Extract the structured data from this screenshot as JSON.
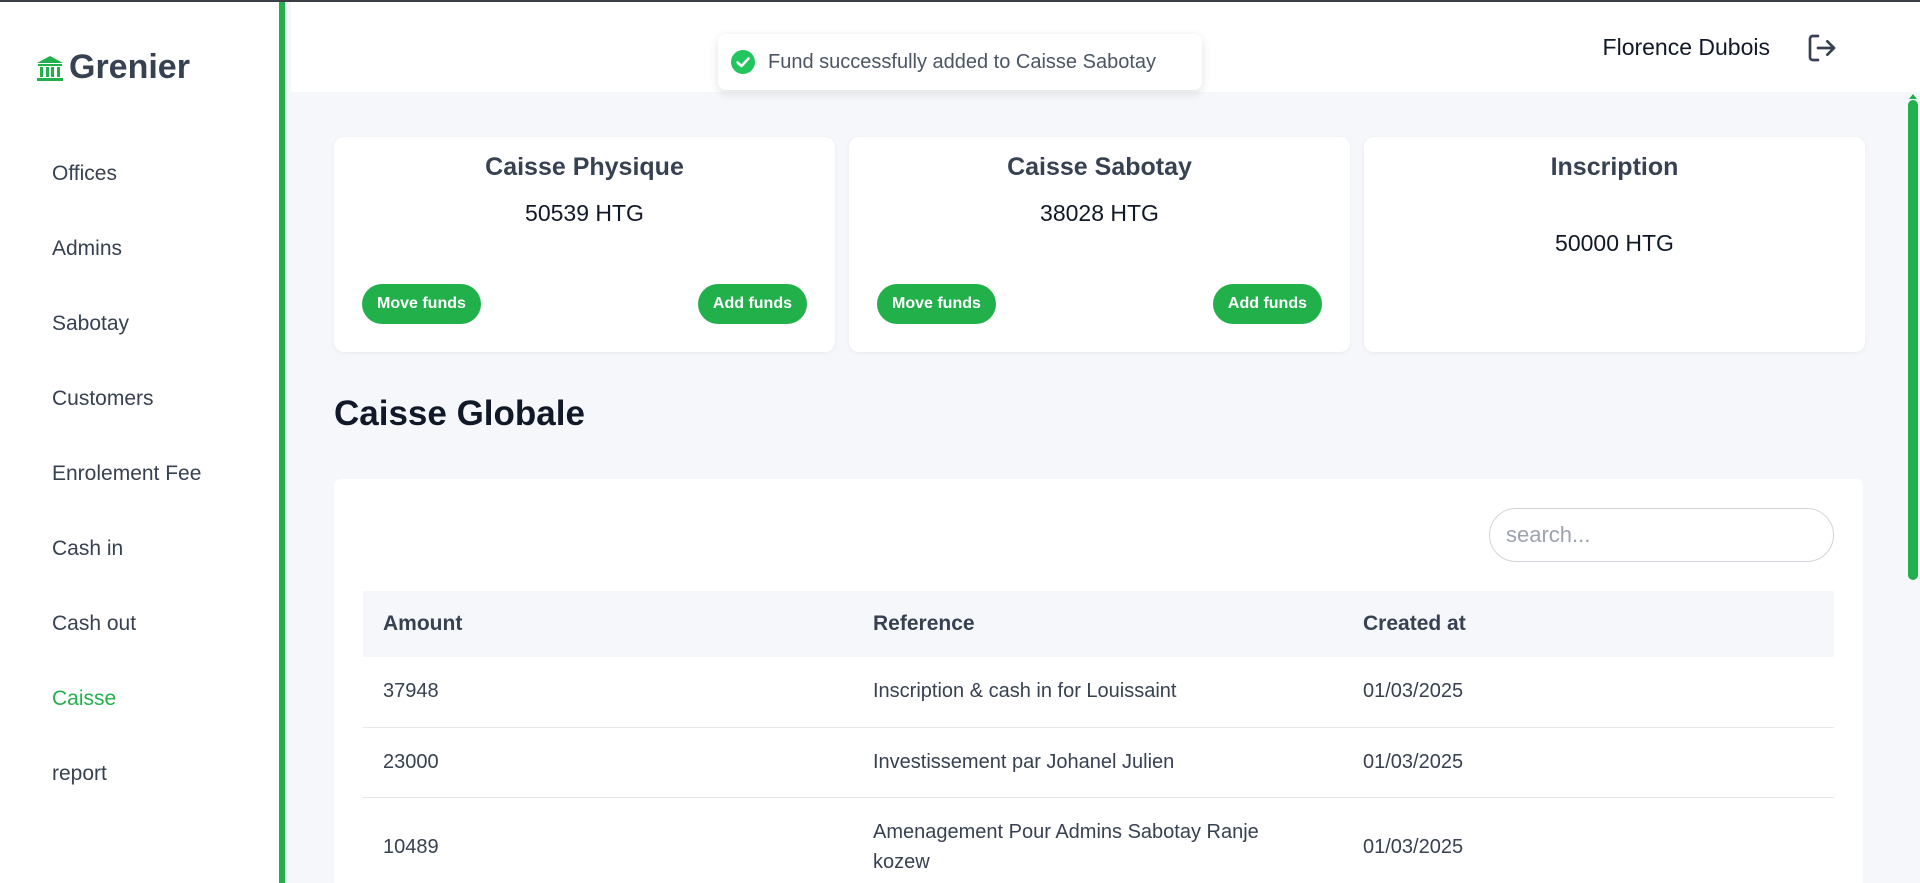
{
  "app": {
    "logo_text": "Grenier",
    "accent_color": "#22b04b"
  },
  "sidebar": {
    "items": [
      {
        "label": "Offices"
      },
      {
        "label": "Admins"
      },
      {
        "label": "Sabotay"
      },
      {
        "label": "Customers"
      },
      {
        "label": "Enrolement Fee"
      },
      {
        "label": "Cash in"
      },
      {
        "label": "Cash out"
      },
      {
        "label": "Caisse",
        "active": true
      },
      {
        "label": "report"
      }
    ]
  },
  "header": {
    "user_name": "Florence Dubois",
    "logout_icon": "logout-icon"
  },
  "toast": {
    "message": "Fund successfully added to Caisse Sabotay",
    "icon": "check-circle-icon"
  },
  "cards": [
    {
      "title": "Caisse Physique",
      "amount": "50539 HTG",
      "move_label": "Move funds",
      "add_label": "Add funds"
    },
    {
      "title": "Caisse Sabotay",
      "amount": "38028 HTG",
      "move_label": "Move funds",
      "add_label": "Add funds"
    },
    {
      "title": "Inscription",
      "amount": "50000 HTG"
    }
  ],
  "section": {
    "title": "Caisse Globale"
  },
  "search": {
    "placeholder": "search..."
  },
  "table": {
    "columns": [
      "Amount",
      "Reference",
      "Created at"
    ],
    "rows": [
      {
        "amount": "37948",
        "reference": "Inscription & cash in for Louissaint",
        "created_at": "01/03/2025"
      },
      {
        "amount": "23000",
        "reference": "Investissement par Johanel Julien",
        "created_at": "01/03/2025"
      },
      {
        "amount": "10489",
        "reference": "Amenagement Pour Admins Sabotay Ranje kozew",
        "created_at": "01/03/2025"
      }
    ]
  }
}
